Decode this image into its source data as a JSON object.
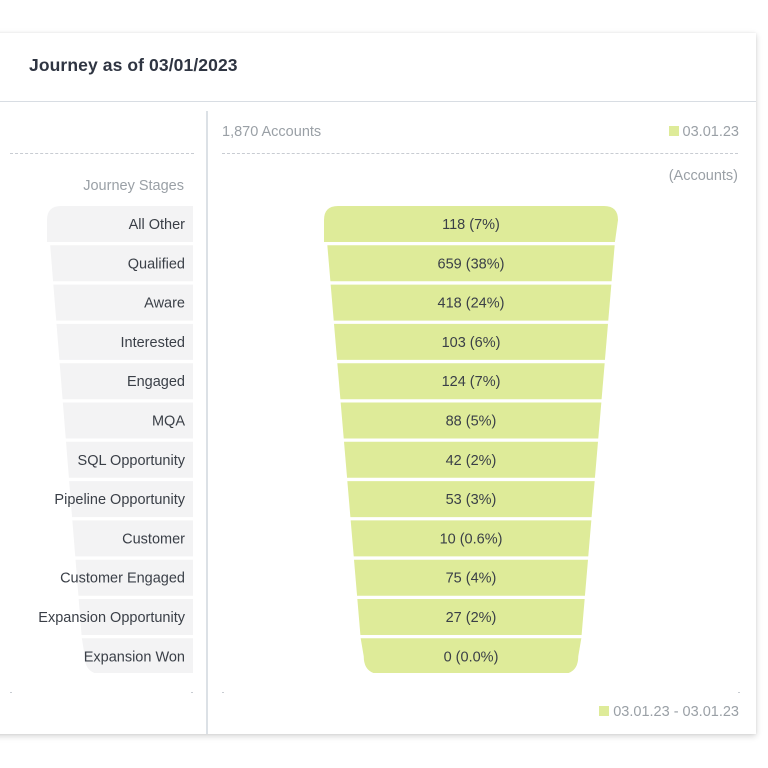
{
  "header": {
    "title": "Journey as of 03/01/2023"
  },
  "left_panel": {
    "column_title": "Journey Stages"
  },
  "right_panel": {
    "total_label": "1,870 Accounts",
    "legend_top": "03.01.23",
    "unit_label": "(Accounts)",
    "legend_bottom": "03.01.23 - 03.01.23"
  },
  "colors": {
    "funnel_fill": "#deeb99",
    "stage_fill": "#f3f3f4",
    "text_dark": "#3a3f47",
    "text_muted": "#9aa0a6"
  },
  "chart_data": {
    "type": "funnel",
    "title": "Journey as of 03/01/2023",
    "xlabel": "",
    "ylabel": "Journey Stages",
    "unit": "Accounts",
    "total": 1870,
    "series_name": "03.01.23",
    "date_range": "03.01.23 - 03.01.23",
    "categories": [
      "All Other",
      "Qualified",
      "Aware",
      "Interested",
      "Engaged",
      "MQA",
      "SQL Opportunity",
      "Pipeline Opportunity",
      "Customer",
      "Customer Engaged",
      "Expansion Opportunity",
      "Expansion Won"
    ],
    "values": [
      118,
      659,
      418,
      103,
      124,
      88,
      42,
      53,
      10,
      75,
      27,
      0
    ],
    "labels": [
      "118 (7%)",
      "659 (38%)",
      "418 (24%)",
      "103 (6%)",
      "124 (7%)",
      "88 (5%)",
      "42 (2%)",
      "53 (3%)",
      "10 (0.6%)",
      "75 (4%)",
      "27 (2%)",
      "0 (0.0%)"
    ]
  }
}
